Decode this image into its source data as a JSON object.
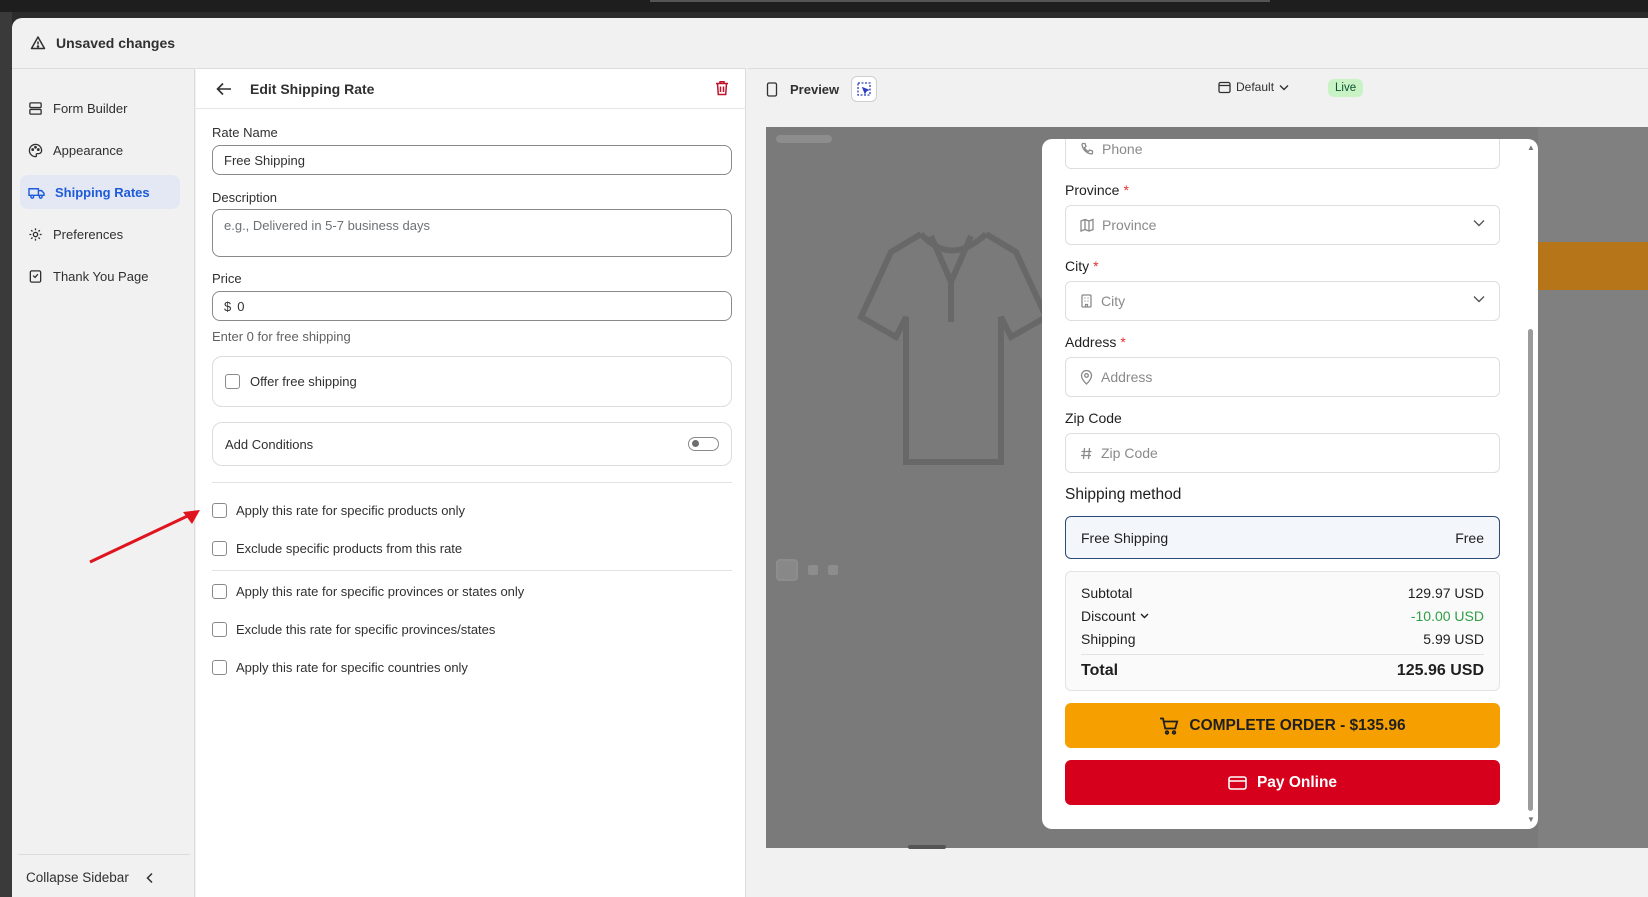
{
  "topbar": {
    "title": "Unsaved changes",
    "icon": "warning-icon"
  },
  "sidebar": {
    "items": [
      {
        "label": "Form Builder",
        "icon": "form-icon",
        "active": false
      },
      {
        "label": "Appearance",
        "icon": "palette-icon",
        "active": false
      },
      {
        "label": "Shipping Rates",
        "icon": "truck-icon",
        "active": true
      },
      {
        "label": "Preferences",
        "icon": "gear-icon",
        "active": false
      },
      {
        "label": "Thank You Page",
        "icon": "page-icon",
        "active": false
      }
    ],
    "collapse_label": "Collapse Sidebar"
  },
  "editor": {
    "title": "Edit Shipping Rate",
    "rate_name": {
      "label": "Rate Name",
      "value": "Free Shipping"
    },
    "description": {
      "label": "Description",
      "placeholder": "e.g., Delivered in 5-7 business days"
    },
    "price": {
      "label": "Price",
      "prefix": "$",
      "value": "0",
      "help": "Enter 0 for free shipping"
    },
    "offer_free_shipping": "Offer free shipping",
    "add_conditions": "Add Conditions",
    "options": [
      "Apply this rate for specific products only",
      "Exclude specific products from this rate",
      "Apply this rate for specific provinces or states only",
      "Exclude this rate for specific provinces/states",
      "Apply this rate for specific countries only"
    ]
  },
  "preview": {
    "title": "Preview",
    "device": "Default",
    "live_badge": "Live",
    "form": {
      "phone_placeholder": "Phone",
      "province": {
        "label": "Province",
        "placeholder": "Province"
      },
      "city": {
        "label": "City",
        "placeholder": "City"
      },
      "address": {
        "label": "Address",
        "placeholder": "Address"
      },
      "zip": {
        "label": "Zip Code",
        "placeholder": "Zip Code"
      },
      "required_mark": "*",
      "shipping_method_title": "Shipping method",
      "shipping_option": {
        "name": "Free Shipping",
        "price": "Free"
      },
      "summary": {
        "subtotal_label": "Subtotal",
        "subtotal": "129.97 USD",
        "discount_label": "Discount",
        "discount": "-10.00 USD",
        "shipping_label": "Shipping",
        "shipping": "5.99 USD",
        "total_label": "Total",
        "total": "125.96 USD"
      },
      "complete_order": "COMPLETE ORDER - $135.96",
      "pay_online": "Pay Online"
    }
  },
  "colors": {
    "active_nav": "#1d5bd8",
    "order_button": "#f59f00",
    "pay_button": "#d6001c",
    "annotation_arrow": "#e0141e"
  }
}
